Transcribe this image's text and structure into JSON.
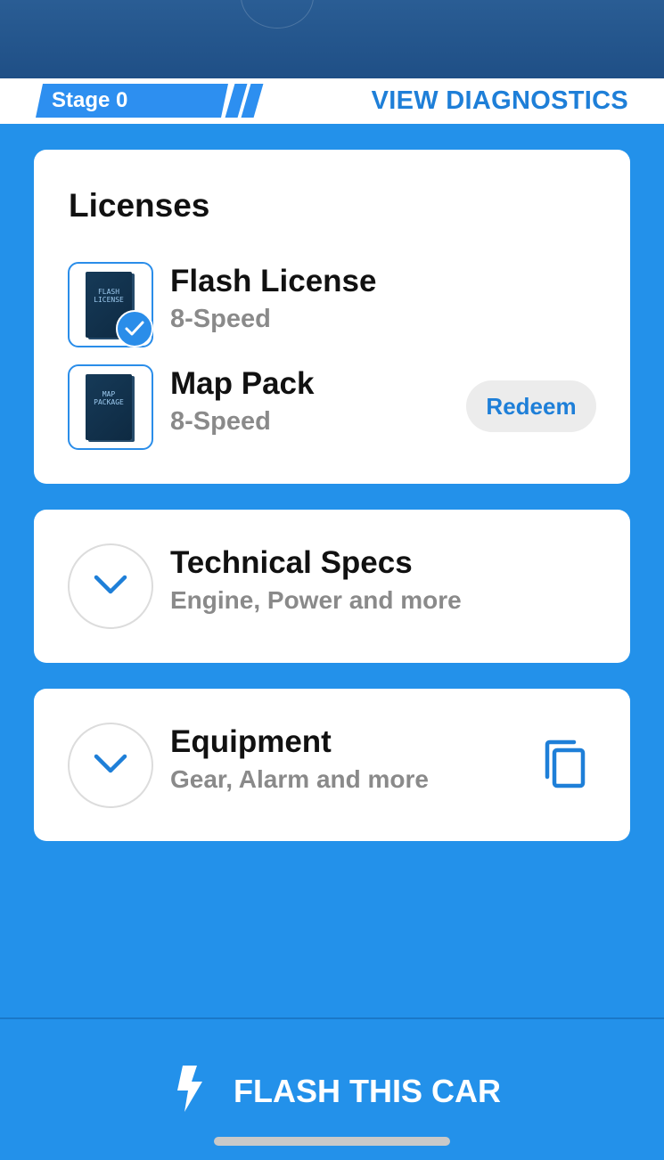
{
  "header": {
    "stage_label": "Stage 0",
    "view_diagnostics_label": "VIEW DIAGNOSTICS"
  },
  "licenses": {
    "title": "Licenses",
    "items": [
      {
        "name": "Flash License",
        "sub": "8-Speed",
        "box_text": "FLASH\nLICENSE",
        "owned": true
      },
      {
        "name": "Map Pack",
        "sub": "8-Speed",
        "box_text": "MAP\nPACKAGE",
        "owned": false,
        "action_label": "Redeem"
      }
    ]
  },
  "sections": [
    {
      "title": "Technical Specs",
      "subtitle": "Engine, Power and more",
      "icon": "chevron-down-icon"
    },
    {
      "title": "Equipment",
      "subtitle": "Gear, Alarm and more",
      "icon": "chevron-down-icon",
      "extra_icon": "copy-icon"
    }
  ],
  "footer": {
    "flash_label": "FLASH THIS CAR",
    "icon": "lightning-bolt-icon"
  },
  "colors": {
    "primary": "#2391ea",
    "accent_text": "#1e7fd8",
    "card": "#ffffff",
    "muted_text": "#8a8a8a"
  }
}
